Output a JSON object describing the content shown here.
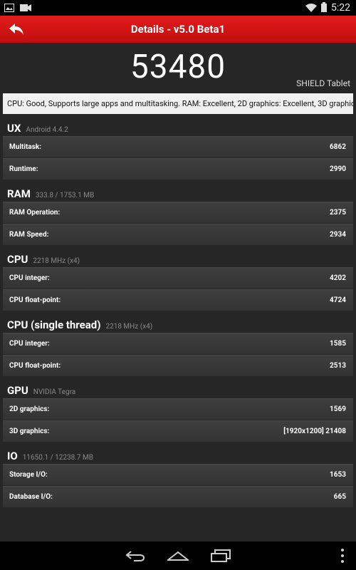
{
  "status_bar": {
    "time": "5:22",
    "icons": [
      "gallery-icon",
      "recorder-icon",
      "wifi-icon",
      "battery-icon"
    ]
  },
  "app_bar": {
    "title": "Details - v5.0 Beta1",
    "back_icon": "back-arrow-icon"
  },
  "score": {
    "value": "53480",
    "device": "SHIELD Tablet"
  },
  "summary": "CPU: Good, Supports large apps and multitasking. RAM: Excellent, 2D graphics: Excellent, 3D graphics:",
  "sections": [
    {
      "name": "UX",
      "sub": "Android 4.4.2",
      "rows": [
        {
          "label": "Multitask:",
          "value": "6862"
        },
        {
          "label": "Runtime:",
          "value": "2990"
        }
      ]
    },
    {
      "name": "RAM",
      "sub": "333.8 / 1753.1 MB",
      "rows": [
        {
          "label": "RAM Operation:",
          "value": "2375"
        },
        {
          "label": "RAM Speed:",
          "value": "2934"
        }
      ]
    },
    {
      "name": "CPU",
      "sub": "2218 MHz (x4)",
      "rows": [
        {
          "label": "CPU integer:",
          "value": "4202"
        },
        {
          "label": "CPU float-point:",
          "value": "4724"
        }
      ]
    },
    {
      "name": "CPU (single thread)",
      "sub": "2218 MHz (x4)",
      "rows": [
        {
          "label": "CPU integer:",
          "value": "1585"
        },
        {
          "label": "CPU float-point:",
          "value": "2513"
        }
      ]
    },
    {
      "name": "GPU",
      "sub": "NVIDIA Tegra",
      "rows": [
        {
          "label": "2D graphics:",
          "value": "1569"
        },
        {
          "label": "3D graphics:",
          "value": "[1920x1200] 21408"
        }
      ]
    },
    {
      "name": "IO",
      "sub": "11650.1 / 12238.7 MB",
      "rows": [
        {
          "label": "Storage I/O:",
          "value": "1653"
        },
        {
          "label": "Database I/O:",
          "value": "665"
        }
      ]
    }
  ],
  "nav_bar": {
    "buttons": [
      "back-nav-icon",
      "home-nav-icon",
      "recents-nav-icon",
      "overflow-menu-icon"
    ]
  }
}
